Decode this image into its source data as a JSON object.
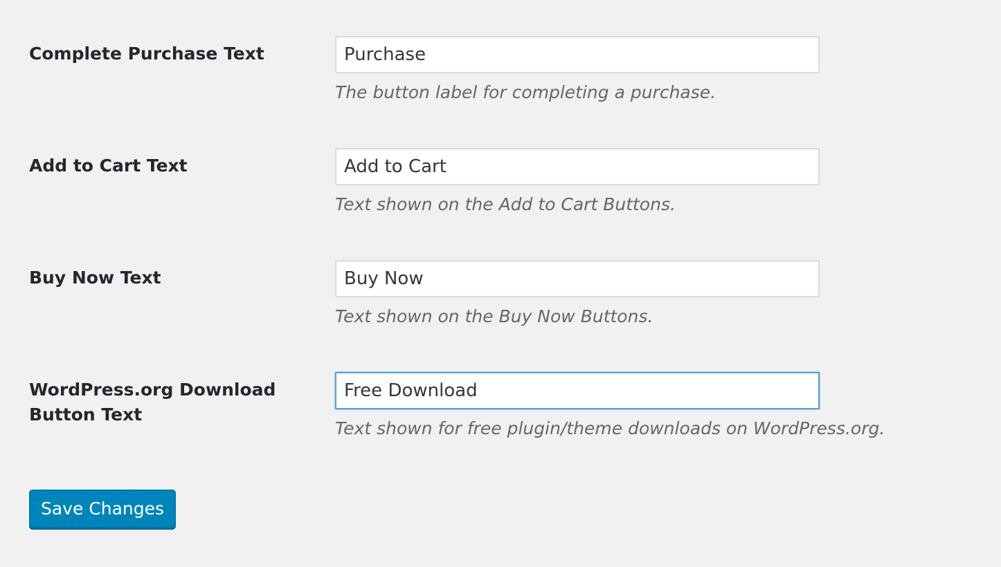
{
  "settings": [
    {
      "label": "Complete Purchase Text",
      "value": "Purchase",
      "description": "The button label for completing a purchase."
    },
    {
      "label": "Add to Cart Text",
      "value": "Add to Cart",
      "description": "Text shown on the Add to Cart Buttons."
    },
    {
      "label": "Buy Now Text",
      "value": "Buy Now",
      "description": "Text shown on the Buy Now Buttons."
    },
    {
      "label": "WordPress.org Download Button Text",
      "value": "Free Download",
      "description": "Text shown for free plugin/theme downloads on WordPress.org."
    }
  ],
  "actions": {
    "save_label": "Save Changes"
  },
  "colors": {
    "background": "#f1f1f1",
    "primary_button": "#0085ba",
    "focus_border": "#5b9dd9"
  }
}
